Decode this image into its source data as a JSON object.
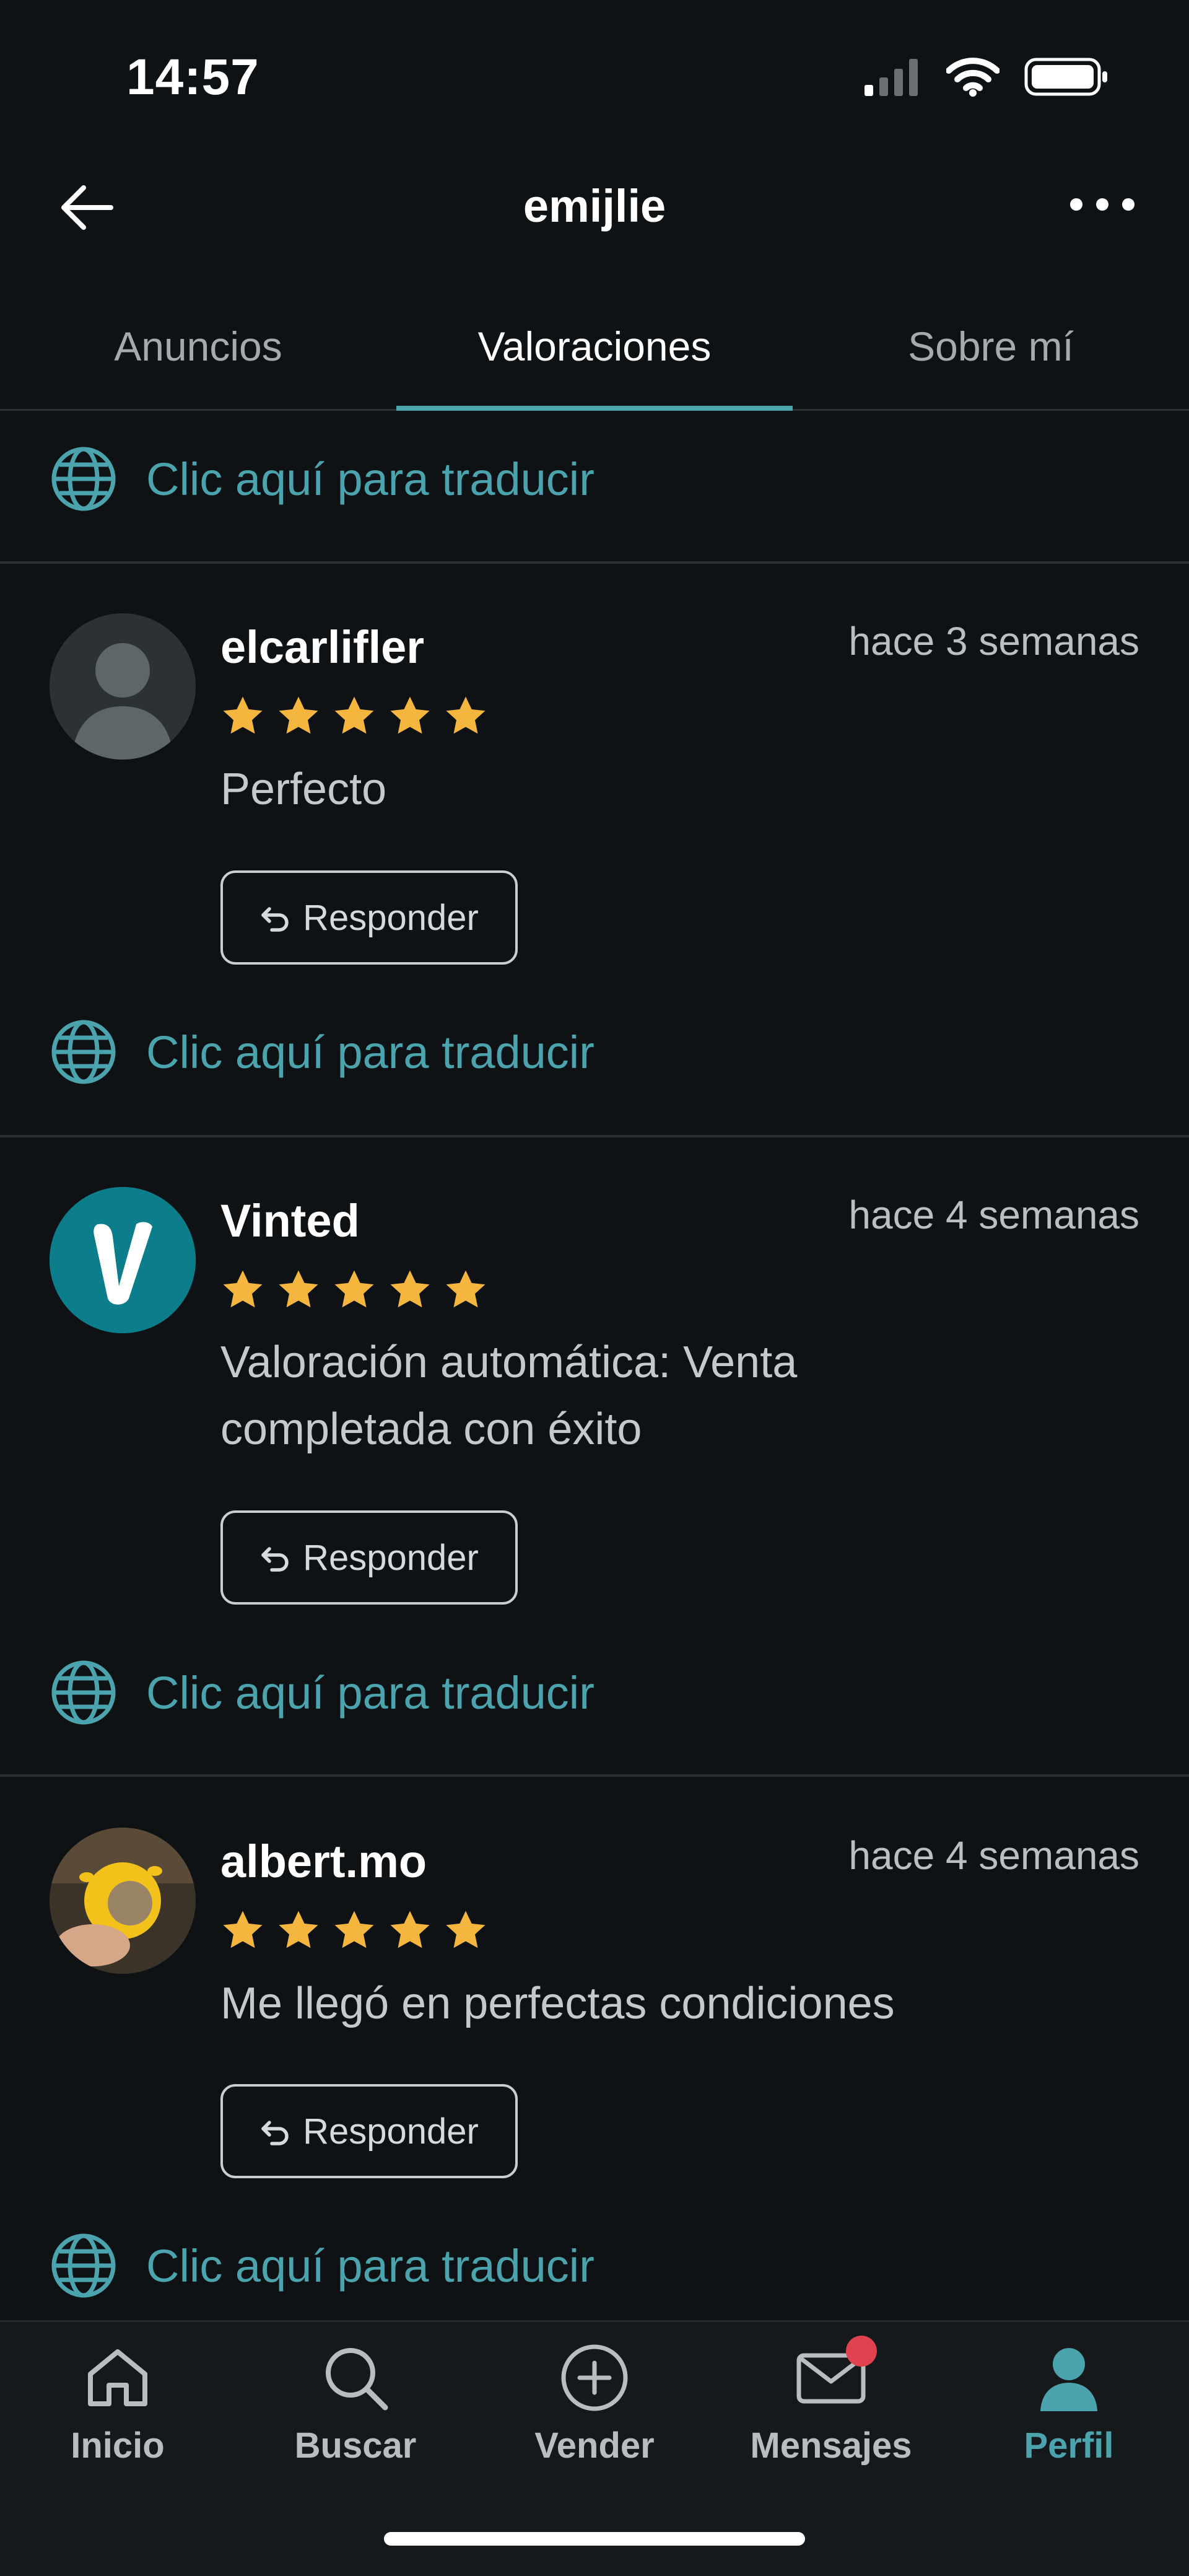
{
  "status_bar": {
    "time": "14:57"
  },
  "header": {
    "title": "emijlie"
  },
  "tabs": [
    {
      "label": "Anuncios",
      "active": false
    },
    {
      "label": "Valoraciones",
      "active": true
    },
    {
      "label": "Sobre mí",
      "active": false
    }
  ],
  "translate_label": "Clic aquí para traducir",
  "reviews": [
    {
      "user": "elcarlifler",
      "time": "hace 3 semanas",
      "rating": 5,
      "comment": "Perfecto",
      "reply_label": "Responder"
    },
    {
      "user": "Vinted",
      "time": "hace 4 semanas",
      "rating": 5,
      "comment": "Valoración automática: Venta completada con éxito",
      "reply_label": "Responder"
    },
    {
      "user": "albert.mo",
      "time": "hace 4 semanas",
      "rating": 5,
      "comment": "Me llegó en perfectas condiciones",
      "reply_label": "Responder"
    }
  ],
  "bottom_nav": [
    {
      "label": "Inicio",
      "icon": "home-icon"
    },
    {
      "label": "Buscar",
      "icon": "search-icon"
    },
    {
      "label": "Vender",
      "icon": "plus-circle-icon"
    },
    {
      "label": "Mensajes",
      "icon": "mail-icon",
      "badge": true
    },
    {
      "label": "Perfil",
      "icon": "profile-icon",
      "active": true
    }
  ],
  "colors": {
    "accent": "#4aa3ad",
    "star": "#f5b63f",
    "background": "#0f1214",
    "badge": "#e0434f"
  }
}
